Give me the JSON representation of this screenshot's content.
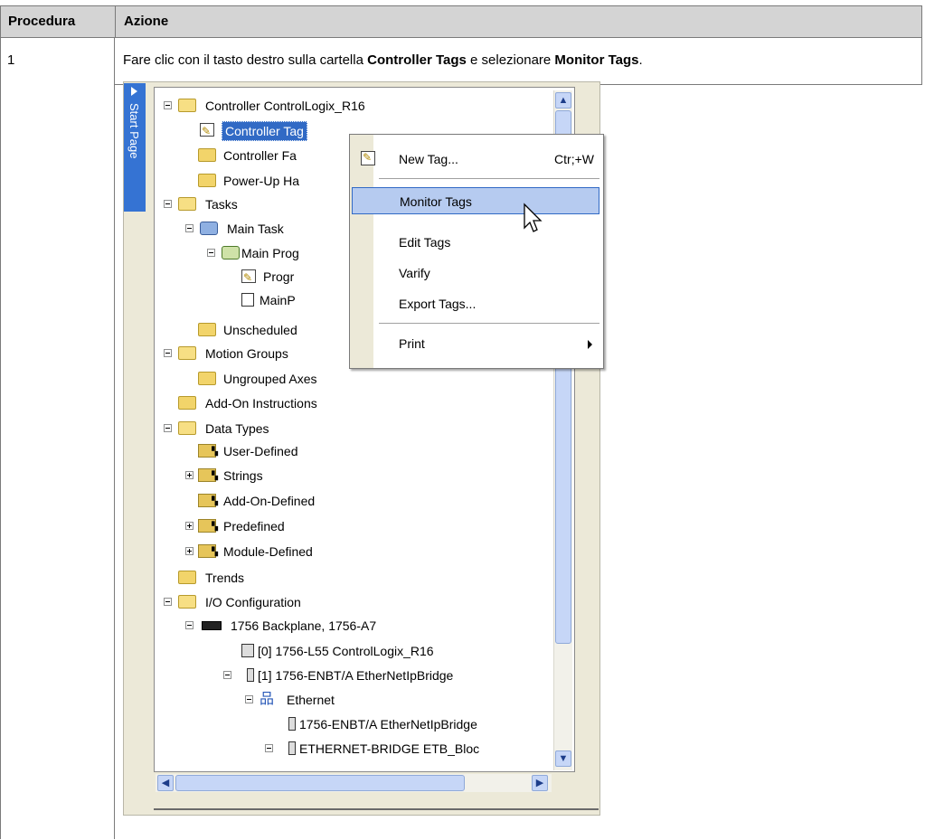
{
  "table": {
    "headers": [
      "Procedura",
      "Azione"
    ],
    "row": {
      "step": "1",
      "instruction": {
        "t1": "Fare clic con il tasto destro sulla cartella ",
        "b1": "Controller Tags",
        "t2": " e selezionare ",
        "b2": "Monitor Tags",
        "t3": "."
      }
    }
  },
  "screenshot": {
    "side_tab": "Start Page",
    "tree": [
      "Controller ControlLogix_R16",
      "Controller Tag",
      "Controller Fa",
      "Power-Up Ha",
      "Tasks",
      "Main Task",
      "Main Prog",
      "Progr",
      "MainP",
      "Unscheduled",
      "Motion Groups",
      "Ungrouped Axes",
      "Add-On Instructions",
      "Data Types",
      "User-Defined",
      "Strings",
      "Add-On-Defined",
      "Predefined",
      "Module-Defined",
      "Trends",
      "I/O Configuration",
      "1756 Backplane, 1756-A7",
      "[0] 1756-L55 ControlLogix_R16",
      "[1] 1756-ENBT/A EtherNetIpBridge",
      "Ethernet",
      "1756-ENBT/A EtherNetIpBridge",
      "ETHERNET-BRIDGE ETB_Bloc"
    ],
    "context_menu": {
      "new_tag": "New Tag...",
      "new_tag_shortcut": "Ctr;+W",
      "monitor_tags": "Monitor Tags",
      "edit_tags": "Edit Tags",
      "verify": "Varify",
      "export_tags": "Export Tags...",
      "print": "Print"
    }
  }
}
